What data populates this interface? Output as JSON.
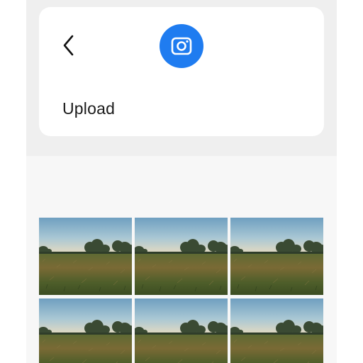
{
  "header": {
    "back_icon": "chevron-left-icon",
    "camera_icon": "camera-icon",
    "title": "Upload"
  },
  "colors": {
    "accent": "#1f7cf0",
    "card": "#ffffff",
    "background": "#efefef"
  },
  "gallery": {
    "thumbnail_count": 6,
    "thumbnail_subject": "landscape-photo"
  }
}
